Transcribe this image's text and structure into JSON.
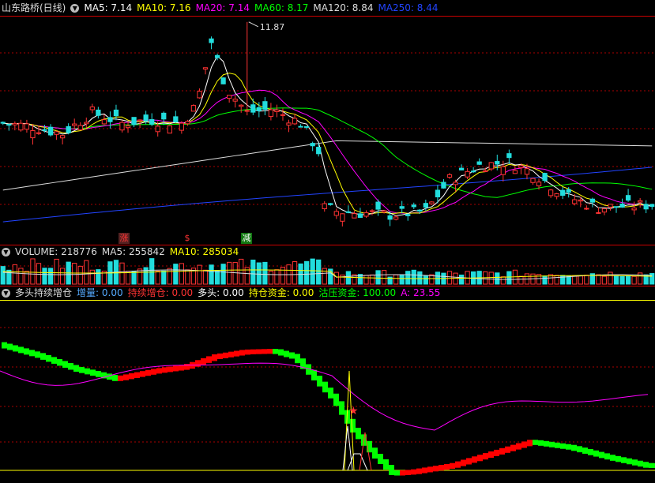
{
  "stock_title": "山东路桥(日线)",
  "price_legend": [
    {
      "label": "MA5: 7.14",
      "color": "#ffffff"
    },
    {
      "label": "MA10: 7.16",
      "color": "#ffff00"
    },
    {
      "label": "MA20: 7.14",
      "color": "#ff00ff"
    },
    {
      "label": "MA60: 8.17",
      "color": "#00ff00"
    },
    {
      "label": "MA120: 8.84",
      "color": "#dddddd"
    },
    {
      "label": "MA250: 8.44",
      "color": "#2244ff"
    }
  ],
  "volume_legend": [
    {
      "label": "VOLUME: 218776",
      "color": "#dddddd"
    },
    {
      "label": "MA5: 255842",
      "color": "#dddddd"
    },
    {
      "label": "MA10: 285034",
      "color": "#ffff00"
    }
  ],
  "indicator_legend": [
    {
      "label": "多头持续增仓",
      "color": "#dddddd"
    },
    {
      "label": "增量: 0.00",
      "color": "#55aaff"
    },
    {
      "label": "持续增仓: 0.00",
      "color": "#ff3333"
    },
    {
      "label": "多头: 0.00",
      "color": "#ffffff"
    },
    {
      "label": "持仓资金: 0.00",
      "color": "#ffff00"
    },
    {
      "label": "沽压资金: 100.00",
      "color": "#00ff00"
    },
    {
      "label": "A: 23.55",
      "color": "#ff00ff"
    }
  ],
  "markers": [
    {
      "text": "涨",
      "color": "#ff3333",
      "bg": "#552222"
    },
    {
      "text": "$",
      "color": "#ff3333",
      "bg": "transparent"
    },
    {
      "text": "减",
      "color": "#ffffff",
      "bg": "#117711"
    }
  ],
  "annotations": {
    "high_label": "11.87"
  },
  "colors": {
    "up": "#ff3333",
    "down": "#22dddd",
    "grid": "#aa0000",
    "ind_up": "#ff0000",
    "ind_down": "#00ff00",
    "ind_line": "#ff00ff"
  },
  "chart_data": {
    "type": "candlestick",
    "price_range": [
      6.0,
      12.0
    ],
    "high_value": 11.87,
    "candles_count": 110
  }
}
